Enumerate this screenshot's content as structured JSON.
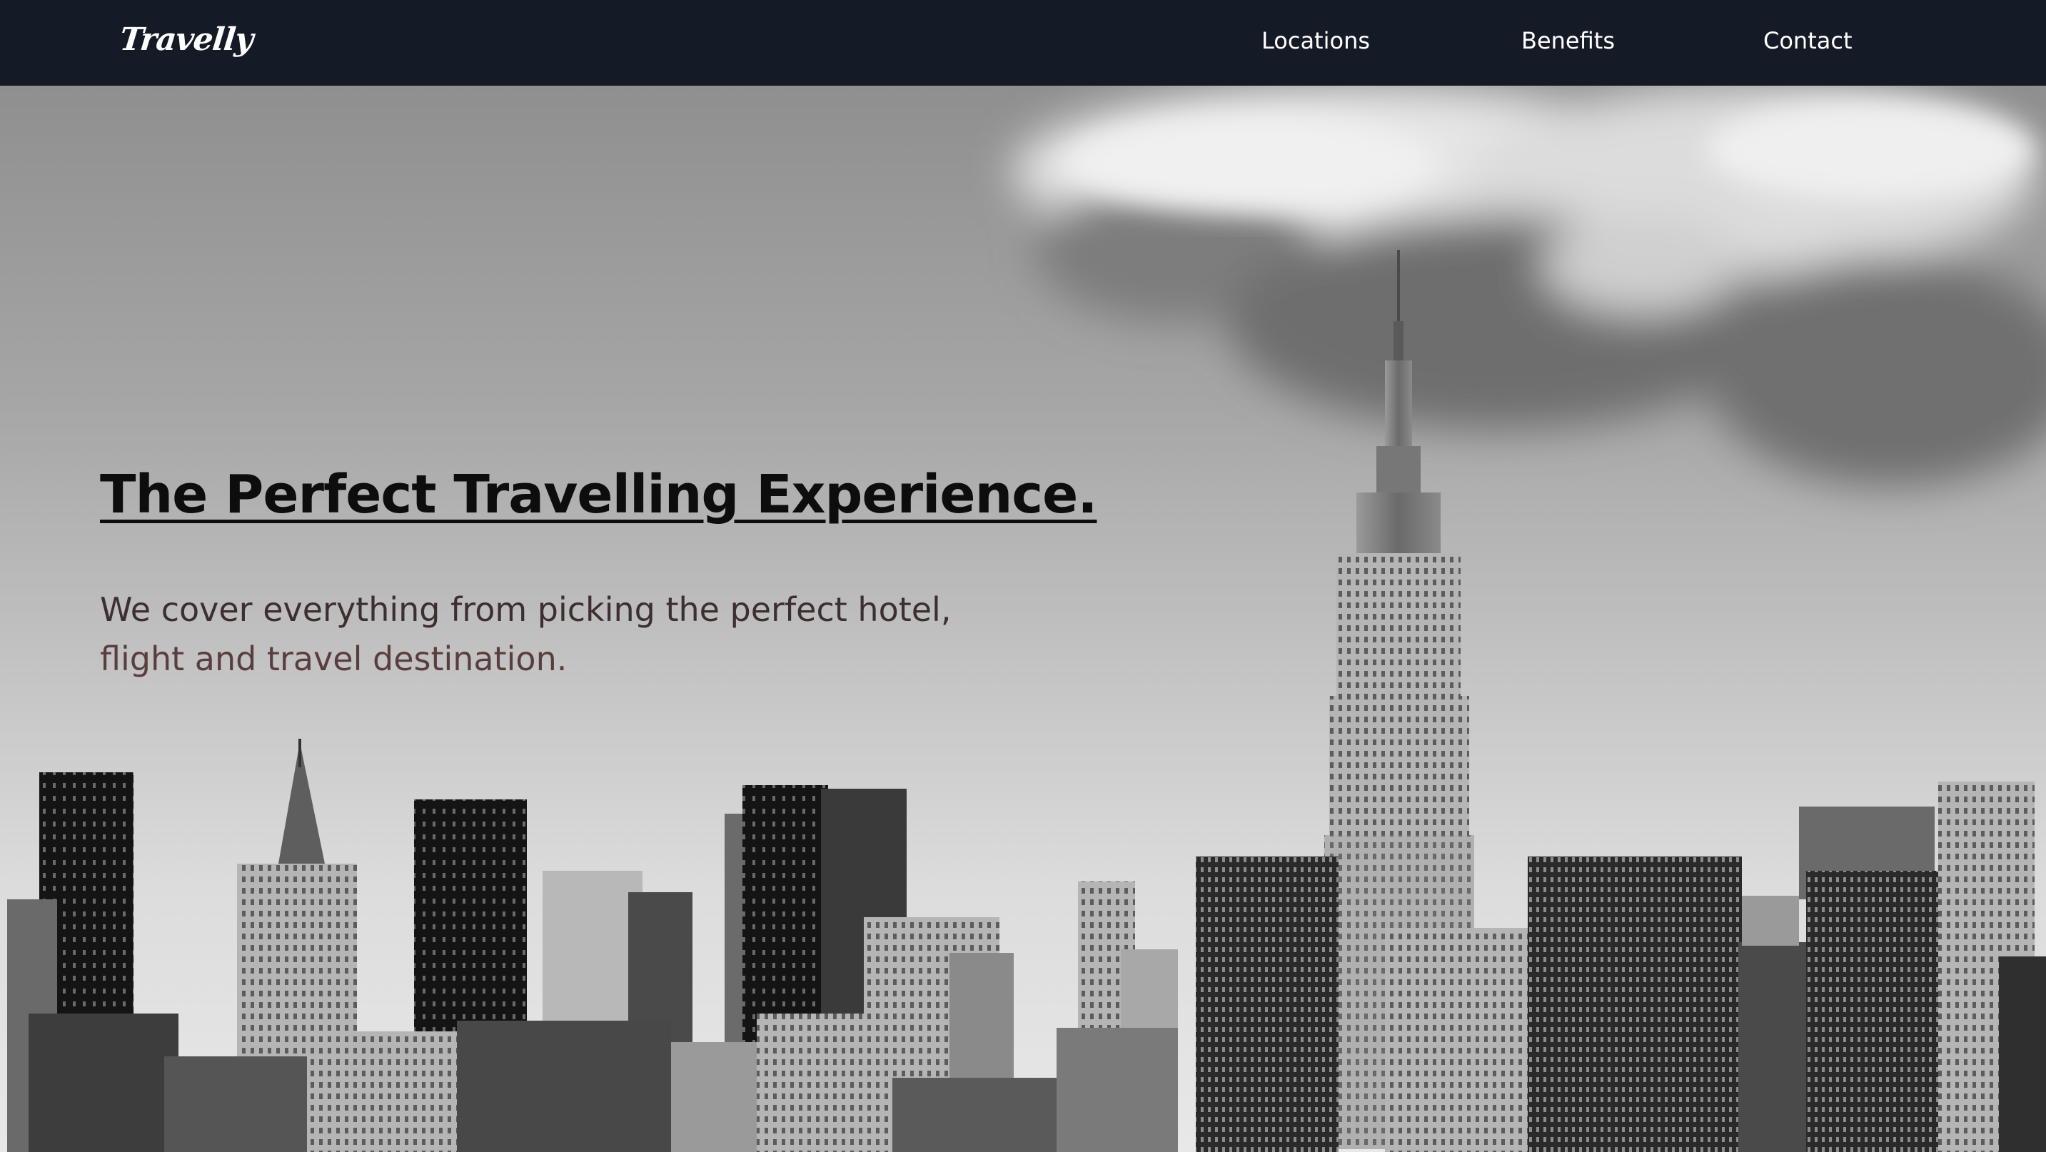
{
  "navbar": {
    "logo": "Travelly",
    "links": [
      "Locations",
      "Benefits",
      "Contact"
    ]
  },
  "hero": {
    "title": "The Perfect Travelling Experience.",
    "subtitle_line1": "We cover everything from picking the perfect hotel,",
    "subtitle_line2": "flight and travel destination.",
    "background_image": "city-skyline-photo"
  },
  "colors": {
    "navbar_bg": "#151b26",
    "nav_text": "#ffffff",
    "title_text": "#0d0d0d",
    "subtitle_text": "#3d2f2f"
  }
}
